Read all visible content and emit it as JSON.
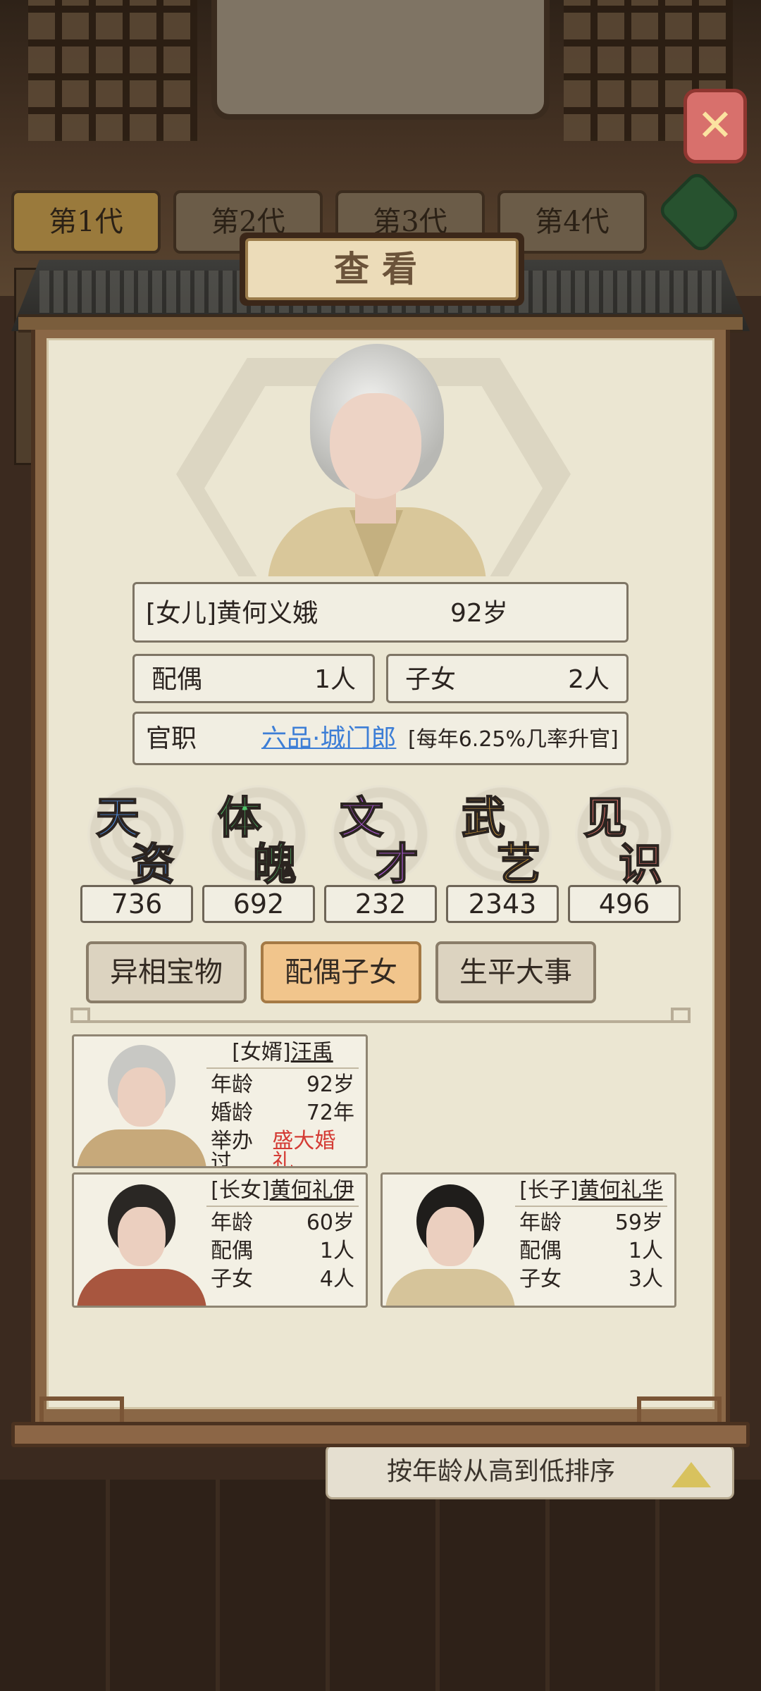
{
  "background": {
    "generation_tabs": [
      "第1代",
      "第2代",
      "第3代",
      "第4代"
    ],
    "sort_label": "按年龄从高到低排序"
  },
  "dialog": {
    "title": "查看",
    "close_label": "✕"
  },
  "person": {
    "name_line": "[女儿]黄何义娥",
    "age": "92岁",
    "spouse_label": "配偶",
    "spouse_count": "1人",
    "children_label": "子女",
    "children_count": "2人",
    "office_label": "官职",
    "office_rank": "六品·城门郎",
    "office_chance": "[每年6.25%几率升官]"
  },
  "stats": [
    {
      "c1": "天",
      "c2": "资",
      "value": "736",
      "color": "#4d8fe6"
    },
    {
      "c1": "体",
      "c2": "魄",
      "value": "692",
      "color": "#4fc46a"
    },
    {
      "c1": "文",
      "c2": "才",
      "value": "232",
      "color": "#b35ae0"
    },
    {
      "c1": "武",
      "c2": "艺",
      "value": "2343",
      "color": "#f0b040"
    },
    {
      "c1": "见",
      "c2": "识",
      "value": "496",
      "color": "#ec7a72"
    }
  ],
  "tabs": [
    "异相宝物",
    "配偶子女",
    "生平大事"
  ],
  "active_tab": "配偶子女",
  "relatives": [
    {
      "tag": "[女婿]",
      "name": "汪禹",
      "r1_label": "年龄",
      "r1_value": "92岁",
      "r2_label": "婚龄",
      "r2_value": "72年",
      "r3_label": "举办过",
      "r3_value": "盛大婚礼"
    },
    {
      "tag": "[长女]",
      "name": "黄何礼伊",
      "r1_label": "年龄",
      "r1_value": "60岁",
      "r2_label": "配偶",
      "r2_value": "1人",
      "r3_label": "子女",
      "r3_value": "4人"
    },
    {
      "tag": "[长子]",
      "name": "黄何礼华",
      "r1_label": "年龄",
      "r1_value": "59岁",
      "r2_label": "配偶",
      "r2_value": "1人",
      "r3_label": "子女",
      "r3_value": "3人"
    }
  ]
}
